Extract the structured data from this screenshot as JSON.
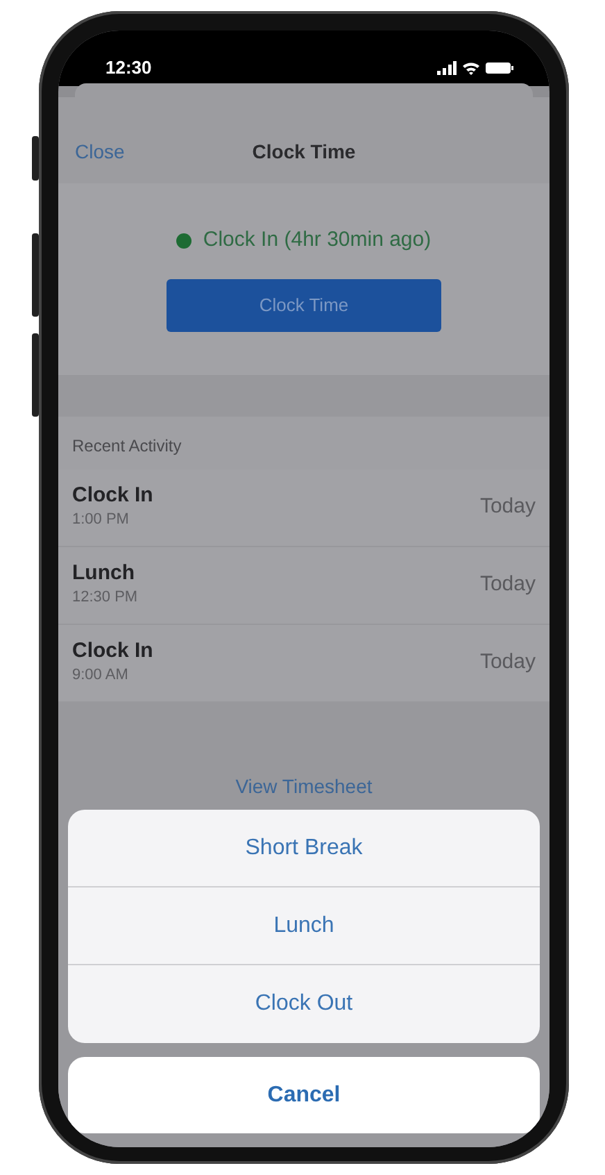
{
  "status_bar": {
    "time": "12:30"
  },
  "nav": {
    "close": "Close",
    "title": "Clock Time"
  },
  "clock_status": {
    "text": "Clock In (4hr 30min ago)",
    "color": "#1d6b33"
  },
  "primary_button": "Clock Time",
  "recent_activity": {
    "header": "Recent Activity",
    "items": [
      {
        "title": "Clock In",
        "time": "1:00 PM",
        "date": "Today"
      },
      {
        "title": "Lunch",
        "time": "12:30 PM",
        "date": "Today"
      },
      {
        "title": "Clock In",
        "time": "9:00 AM",
        "date": "Today"
      }
    ]
  },
  "link": "View Timesheet",
  "action_sheet": {
    "options": [
      "Short Break",
      "Lunch",
      "Clock Out"
    ],
    "cancel": "Cancel"
  }
}
